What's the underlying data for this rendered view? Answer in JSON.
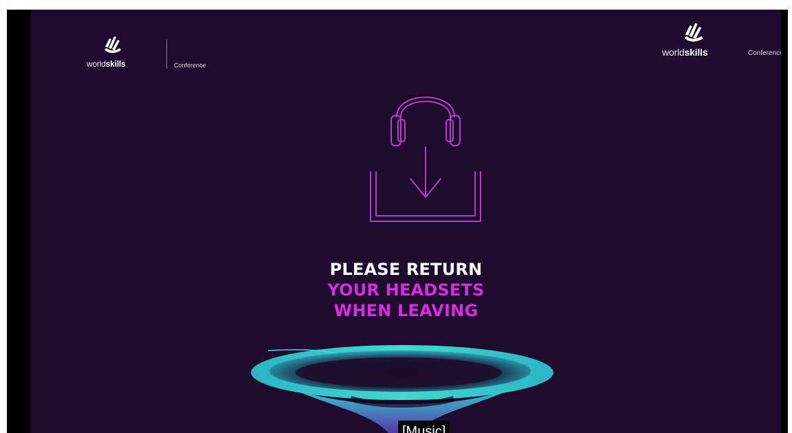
{
  "logo_left": {
    "word_light": "world",
    "word_bold": "skills",
    "conference": "Conference"
  },
  "logo_right": {
    "word_light": "world",
    "word_bold": "skills",
    "conference": "Conference"
  },
  "illustration": {
    "icon": "headphones-return-icon",
    "stroke_color": "#b63fc9"
  },
  "message": {
    "line1": "PLEASE RETURN",
    "line2": "YOUR HEADSETS",
    "line3": "WHEN LEAVING"
  },
  "caption": {
    "text": "[Music]"
  },
  "colors": {
    "background": "#1f0b2e",
    "accent": "#d42ee0",
    "funnel_glow": "#3fe3d6"
  }
}
